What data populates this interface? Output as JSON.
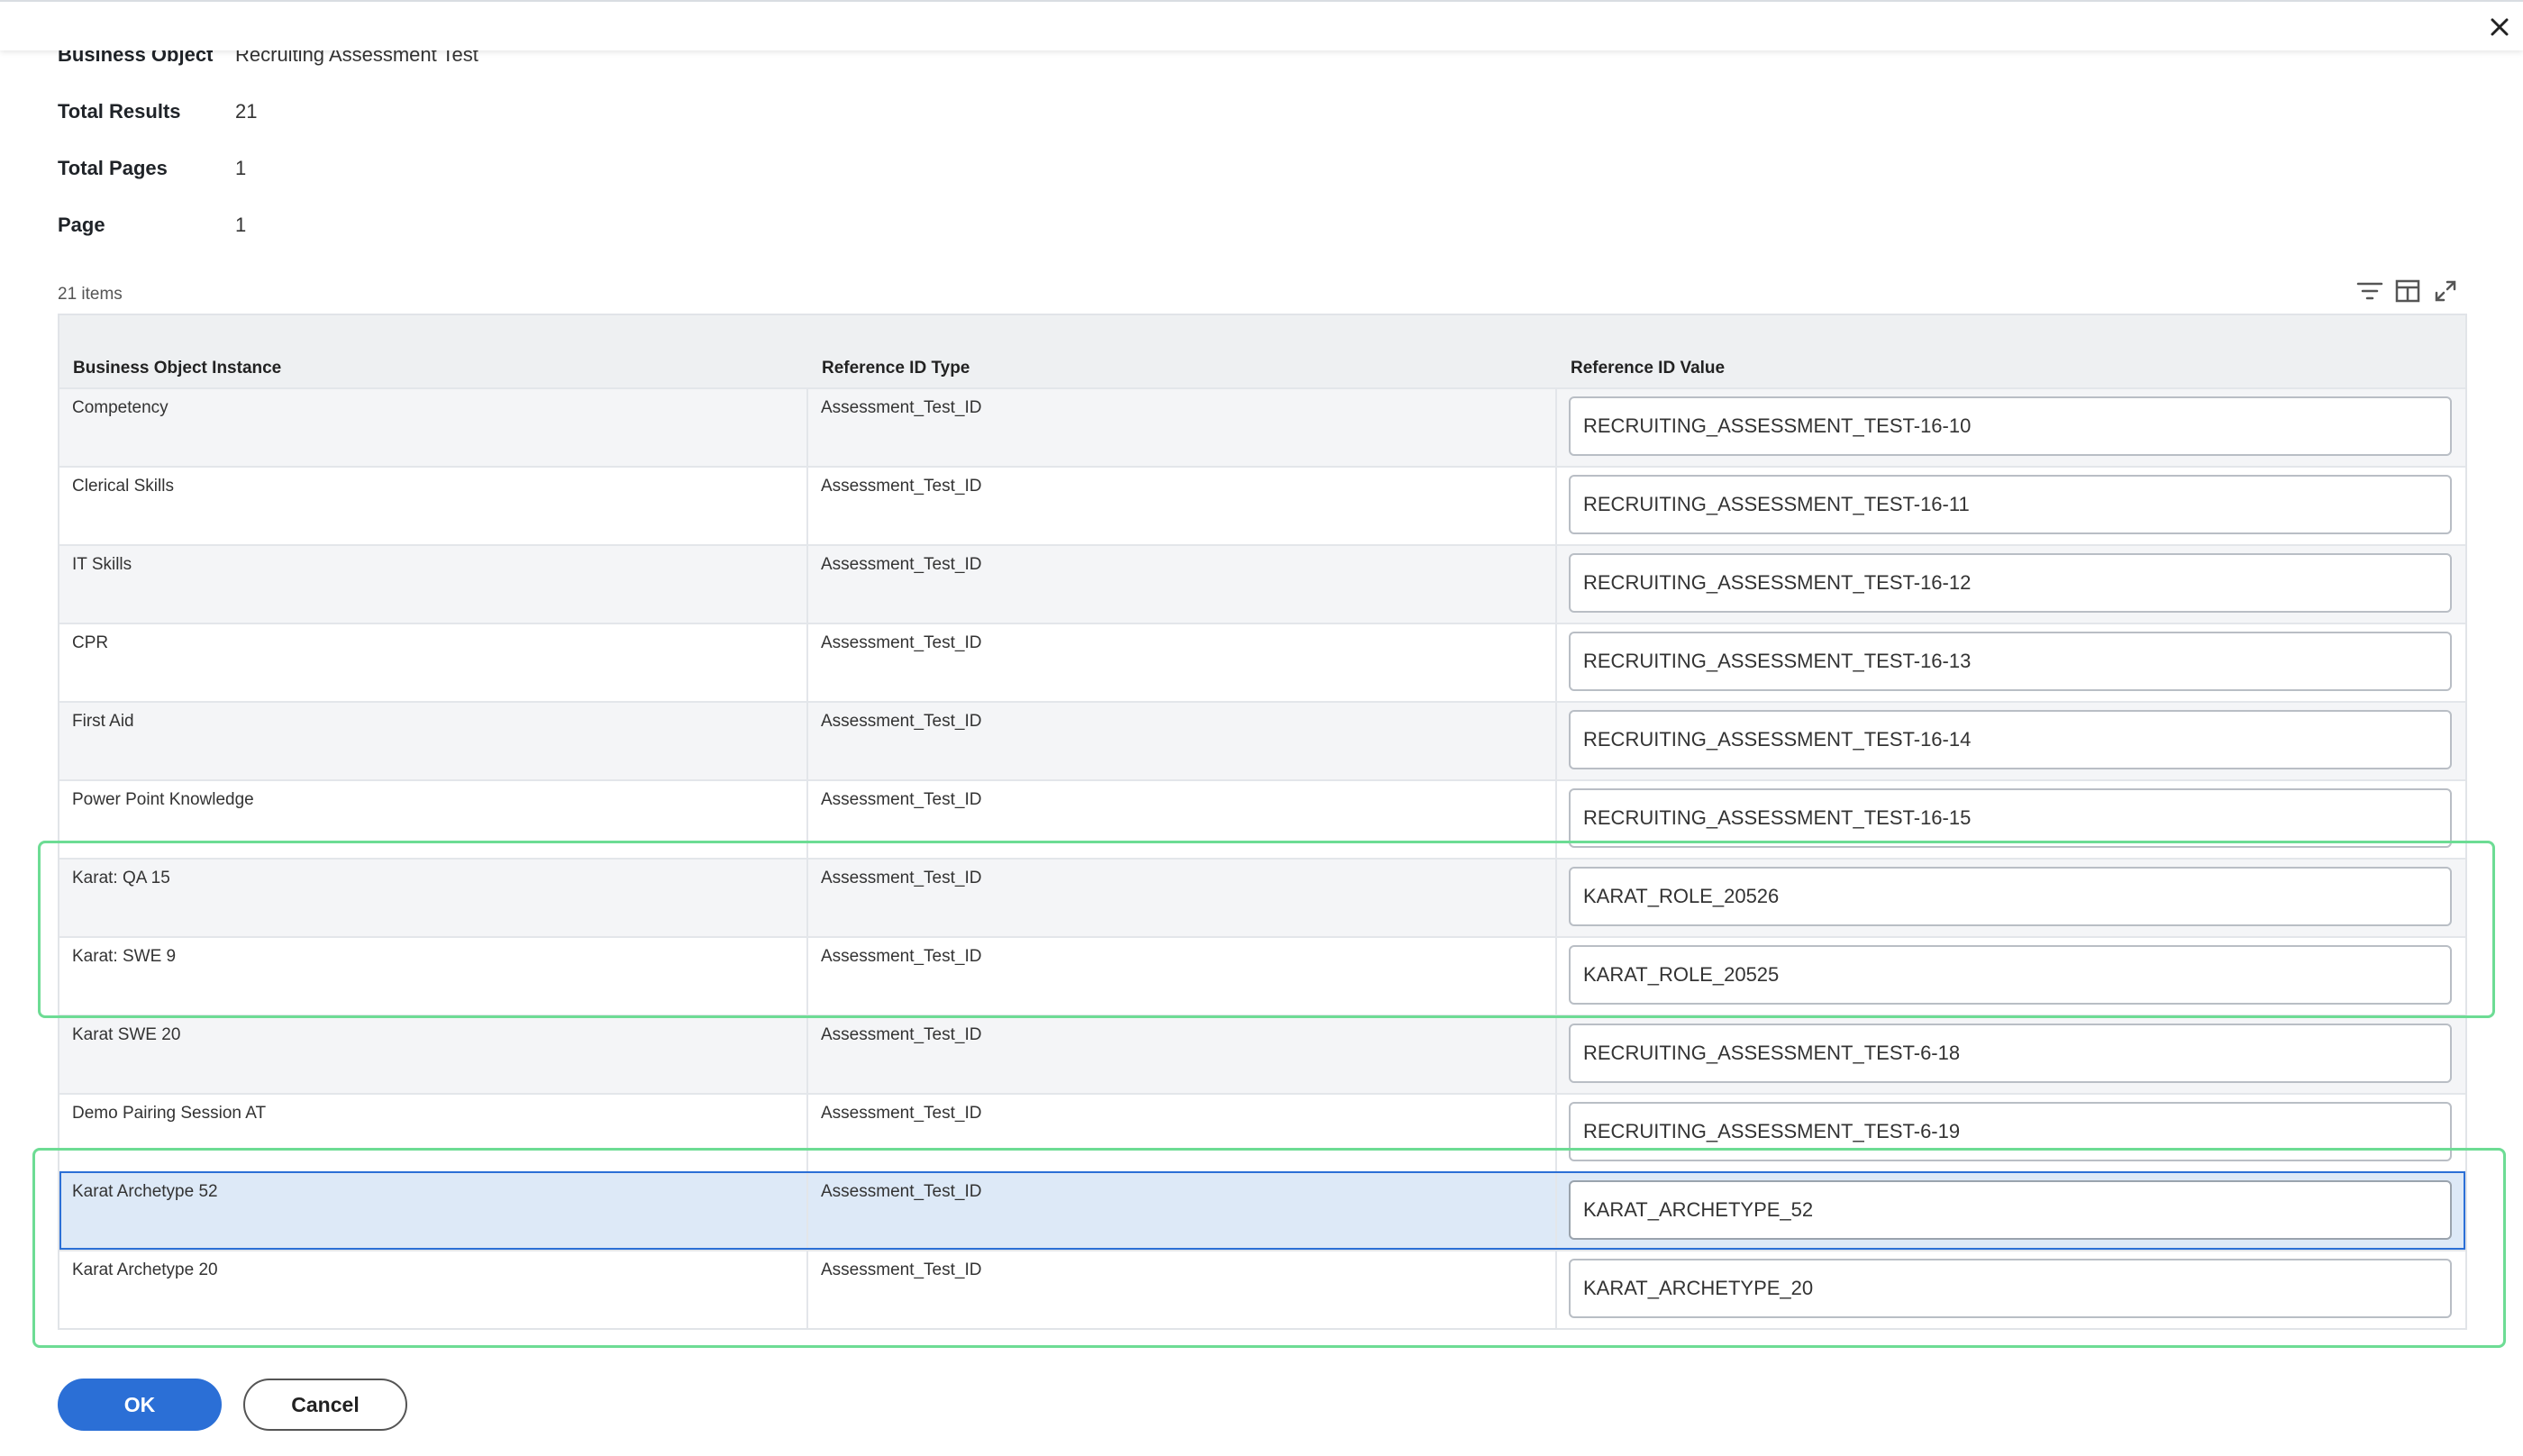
{
  "meta": [
    {
      "label": "Business Object",
      "value": "Recruiting Assessment Test"
    },
    {
      "label": "Total Results",
      "value": "21"
    },
    {
      "label": "Total Pages",
      "value": "1"
    },
    {
      "label": "Page",
      "value": "1"
    }
  ],
  "grid": {
    "items_count": "21 items",
    "tools": [
      "filter-icon",
      "columns-icon",
      "expand-icon"
    ],
    "headers": [
      "Business Object Instance",
      "Reference ID Type",
      "Reference ID Value"
    ],
    "rows": [
      {
        "instance": "Competency",
        "type": "Assessment_Test_ID",
        "value": "RECRUITING_ASSESSMENT_TEST-16-10"
      },
      {
        "instance": "Clerical Skills",
        "type": "Assessment_Test_ID",
        "value": "RECRUITING_ASSESSMENT_TEST-16-11"
      },
      {
        "instance": "IT Skills",
        "type": "Assessment_Test_ID",
        "value": "RECRUITING_ASSESSMENT_TEST-16-12"
      },
      {
        "instance": "CPR",
        "type": "Assessment_Test_ID",
        "value": "RECRUITING_ASSESSMENT_TEST-16-13"
      },
      {
        "instance": "First Aid",
        "type": "Assessment_Test_ID",
        "value": "RECRUITING_ASSESSMENT_TEST-16-14"
      },
      {
        "instance": "Power Point Knowledge",
        "type": "Assessment_Test_ID",
        "value": "RECRUITING_ASSESSMENT_TEST-16-15"
      },
      {
        "instance": "Karat: QA 15",
        "type": "Assessment_Test_ID",
        "value": "KARAT_ROLE_20526"
      },
      {
        "instance": "Karat: SWE 9",
        "type": "Assessment_Test_ID",
        "value": "KARAT_ROLE_20525"
      },
      {
        "instance": "Karat SWE 20",
        "type": "Assessment_Test_ID",
        "value": "RECRUITING_ASSESSMENT_TEST-6-18"
      },
      {
        "instance": "Demo Pairing Session AT",
        "type": "Assessment_Test_ID",
        "value": "RECRUITING_ASSESSMENT_TEST-6-19"
      },
      {
        "instance": "Karat Archetype 52",
        "type": "Assessment_Test_ID",
        "value": "KARAT_ARCHETYPE_52",
        "selected": true
      },
      {
        "instance": "Karat Archetype 20",
        "type": "Assessment_Test_ID",
        "value": "KARAT_ARCHETYPE_20"
      }
    ]
  },
  "footer": {
    "ok_label": "OK",
    "cancel_label": "Cancel"
  },
  "colors": {
    "primary": "#2b6fd6",
    "highlight": "#6ddc94",
    "selected_row": "#dde9f7"
  },
  "icons": {
    "close": "close-icon"
  }
}
